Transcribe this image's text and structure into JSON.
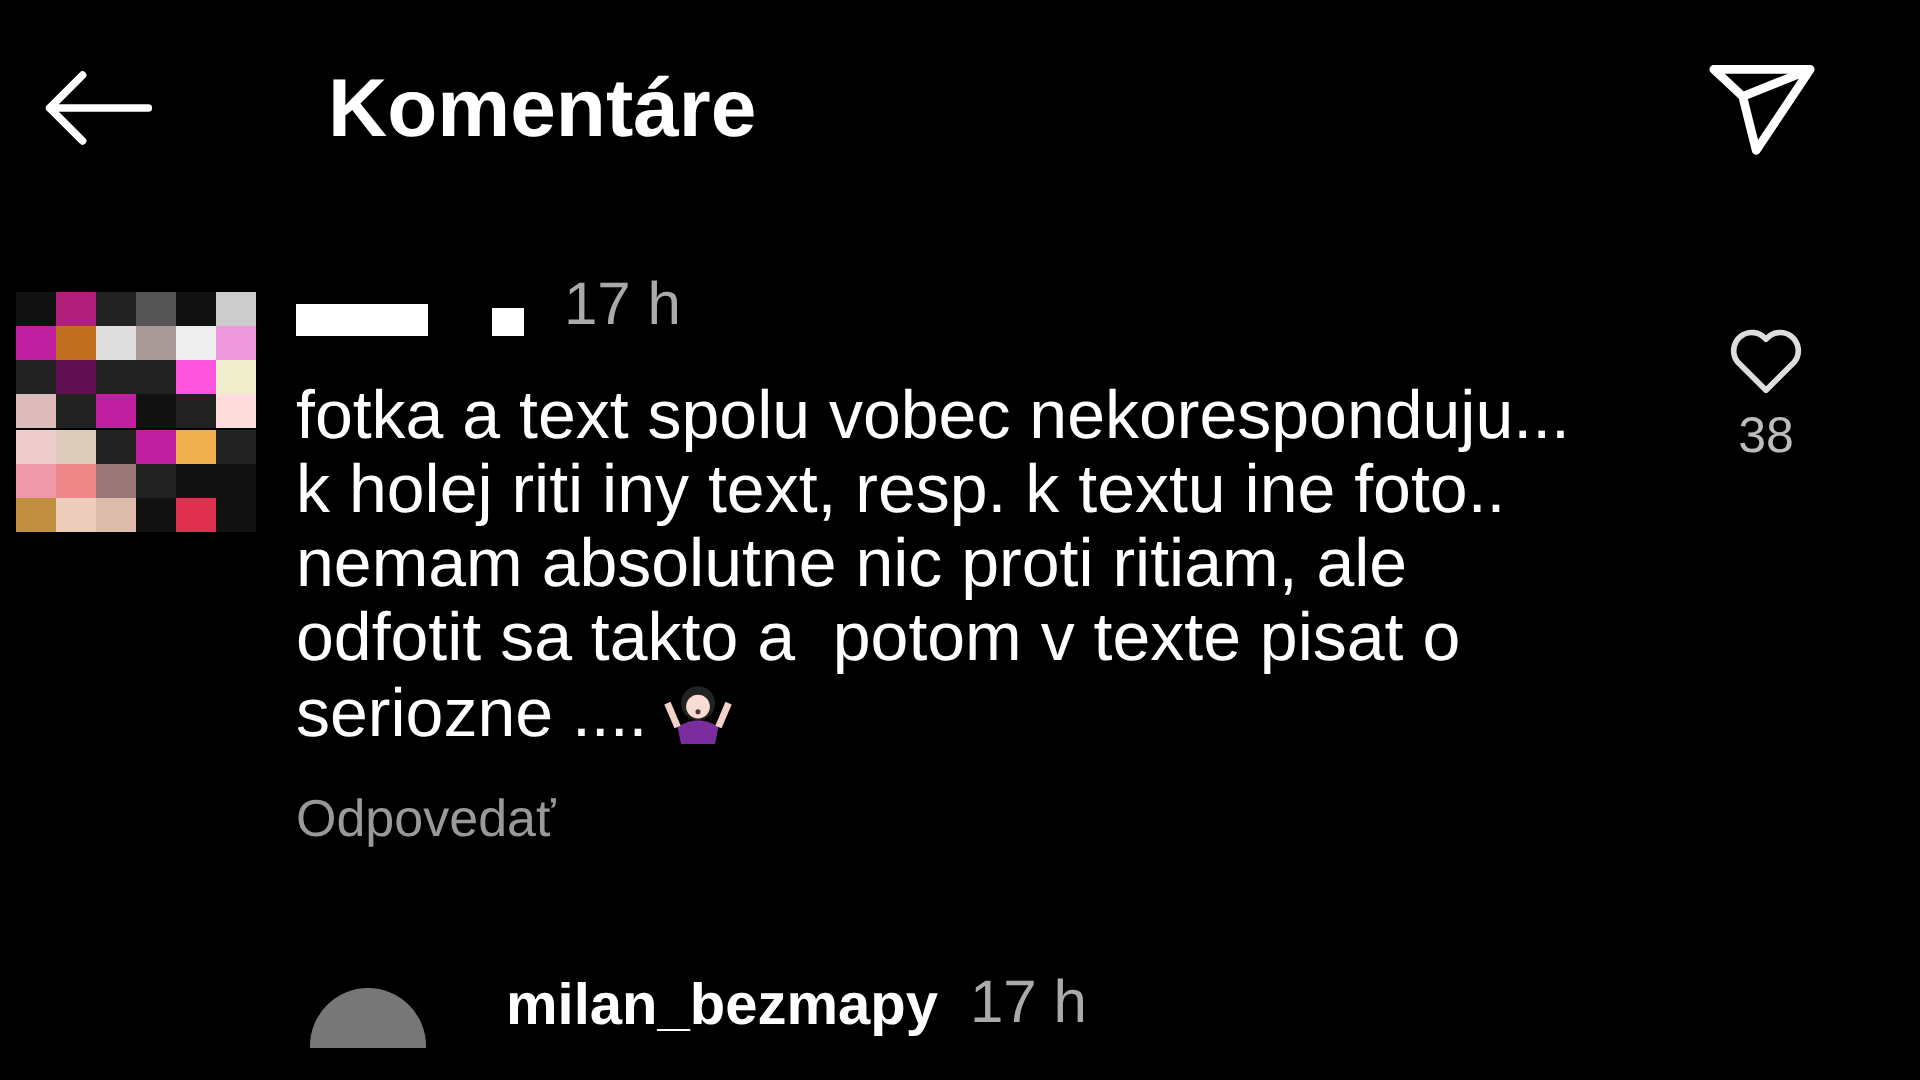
{
  "header": {
    "title": "Komentáre"
  },
  "comments": [
    {
      "username_redacted": true,
      "time": "17 h",
      "text": "fotka a text spolu vobec nekoresponduju...\nk holej riti iny text, resp. k textu ine foto..\nnemam absolutne nic proti ritiam, ale\nodfotit sa takto a  potom v texte pisat o\nseriozne ....",
      "emoji": true,
      "reply": "Odpovedať",
      "likes": "38"
    },
    {
      "username_redacted": false,
      "username": "milan_bezmapy",
      "time": "17 h"
    }
  ]
}
